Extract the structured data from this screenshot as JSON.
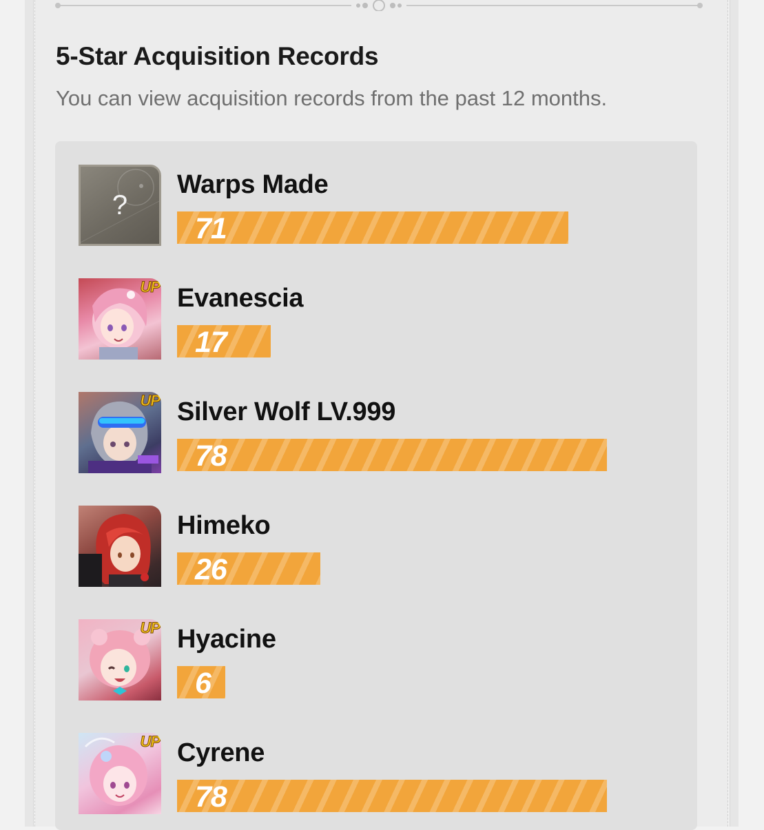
{
  "section": {
    "title": "5-Star Acquisition Records",
    "subtitle": "You can view acquisition records from the past 12 months."
  },
  "records": [
    {
      "name": "Warps Made",
      "count": "71",
      "value": 71,
      "avatar": "unknown-question-icon",
      "up": ""
    },
    {
      "name": "Evanescia",
      "count": "17",
      "value": 17,
      "avatar": "character-portrait",
      "up": "UP"
    },
    {
      "name": "Silver Wolf LV.999",
      "count": "78",
      "value": 78,
      "avatar": "character-portrait",
      "up": "UP"
    },
    {
      "name": "Himeko",
      "count": "26",
      "value": 26,
      "avatar": "character-portrait",
      "up": ""
    },
    {
      "name": "Hyacine",
      "count": "6",
      "value": 6,
      "avatar": "character-portrait",
      "up": "UP"
    },
    {
      "name": "Cyrene",
      "count": "78",
      "value": 78,
      "avatar": "character-portrait",
      "up": "UP"
    }
  ],
  "avatar_unknown_glyph": "?",
  "colors": {
    "bar": "#f2a53b",
    "up_badge": "#f3c21a",
    "panel": "#ececec",
    "records_bg": "#e0e0e0"
  }
}
